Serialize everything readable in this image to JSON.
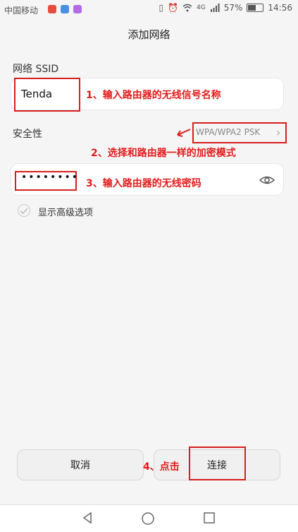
{
  "status_bar": {
    "carrier": "中国移动",
    "battery": "57%",
    "time": "14:56",
    "network": "4G"
  },
  "header": {
    "title": "添加网络"
  },
  "form": {
    "ssid_label": "网络 SSID",
    "ssid_value": "Tenda",
    "security_label": "安全性",
    "security_value": "WPA/WPA2 PSK",
    "password_dots": "••••••••",
    "advanced_label": "显示高级选项"
  },
  "annotations": {
    "a1": "1、输入路由器的无线信号名称",
    "a2": "2、选择和路由器一样的加密模式",
    "a3": "3、输入路由器的无线密码",
    "a4": "4、点击"
  },
  "buttons": {
    "cancel": "取消",
    "connect": "连接"
  },
  "colors": {
    "accent_red": "#d81e1e",
    "annotation_red": "#e21b1b"
  }
}
